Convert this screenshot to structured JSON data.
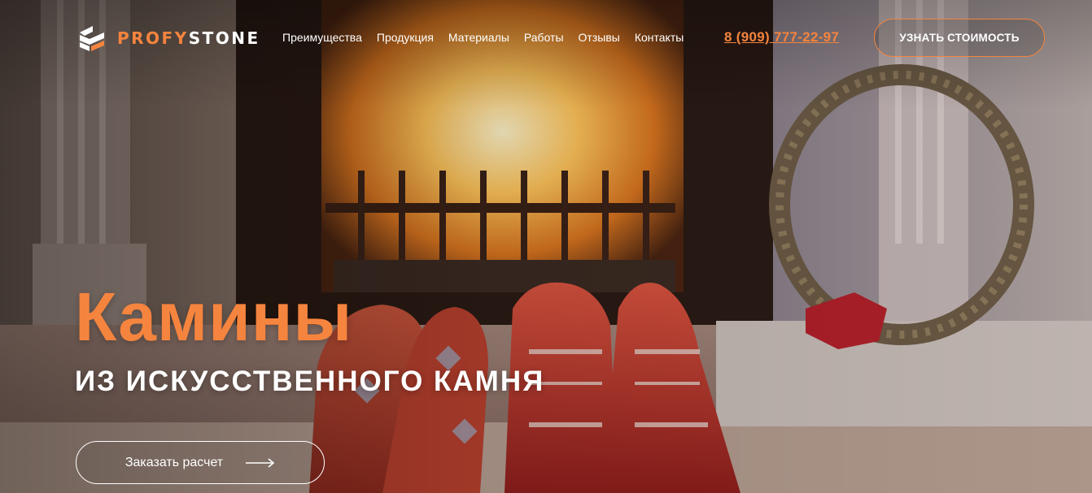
{
  "header": {
    "logo": {
      "accent": "PROFY",
      "rest": "STONE",
      "icon": "stone-logo-icon"
    },
    "nav": [
      {
        "label": "Преимущества"
      },
      {
        "label": "Продукция"
      },
      {
        "label": "Материалы"
      },
      {
        "label": "Работы"
      },
      {
        "label": "Отзывы"
      },
      {
        "label": "Контакты"
      }
    ],
    "phone": "8 (909) 777-22-97",
    "cta_label": "УЗНАТЬ СТОИМОСТЬ"
  },
  "hero": {
    "title": "Камины",
    "subtitle": "ИЗ ИСКУССТВЕННОГО КАМНЯ",
    "order_button_label": "Заказать расчет",
    "order_button_icon": "arrow-right-icon"
  },
  "colors": {
    "accent": "#f5843e",
    "text": "#ffffff"
  }
}
